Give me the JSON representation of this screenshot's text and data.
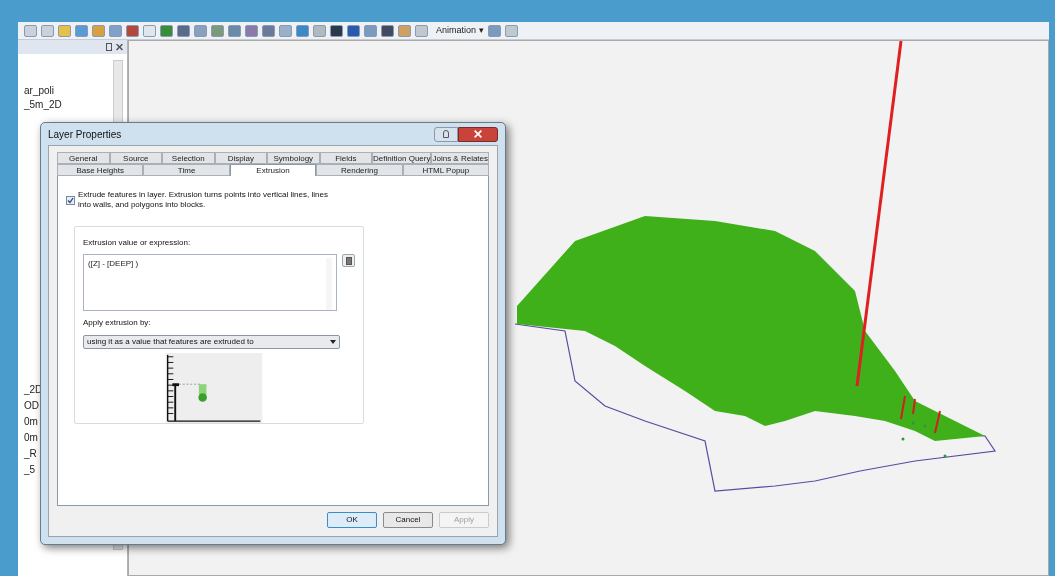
{
  "toolbar": {
    "animation_menu": "Animation ▾"
  },
  "toc": {
    "items_top": [
      "ar_poli",
      "_5m_2D"
    ],
    "items_bottom": [
      "_2D",
      "OD",
      "0m",
      "0m",
      "_R",
      "_5"
    ]
  },
  "dialog": {
    "title": "Layer Properties",
    "tab_rows": [
      [
        {
          "label": "General",
          "selected": false
        },
        {
          "label": "Source",
          "selected": false
        },
        {
          "label": "Selection",
          "selected": false
        },
        {
          "label": "Display",
          "selected": false
        },
        {
          "label": "Symbology",
          "selected": false
        },
        {
          "label": "Fields",
          "selected": false
        },
        {
          "label": "Definition Query",
          "selected": false
        },
        {
          "label": "Joins & Relates",
          "selected": false
        }
      ],
      [
        {
          "label": "Base Heights",
          "selected": false
        },
        {
          "label": "Time",
          "selected": false
        },
        {
          "label": "Extrusion",
          "selected": true
        },
        {
          "label": "Rendering",
          "selected": false
        },
        {
          "label": "HTML Popup",
          "selected": false
        }
      ]
    ],
    "extrude": {
      "checked": true,
      "label": "Extrude features in layer.  Extrusion turns points into vertical lines, lines into walls, and polygons into blocks."
    },
    "expression_label": "Extrusion value or expression:",
    "expression_value": "([Z] - [DEEP] )",
    "apply_label": "Apply extrusion by:",
    "apply_value": "using it as a value that features are extruded to",
    "buttons": [
      {
        "label": "OK",
        "disabled": false,
        "default": true
      },
      {
        "label": "Cancel",
        "disabled": false,
        "default": false
      },
      {
        "label": "Apply",
        "disabled": true,
        "default": false
      }
    ]
  }
}
